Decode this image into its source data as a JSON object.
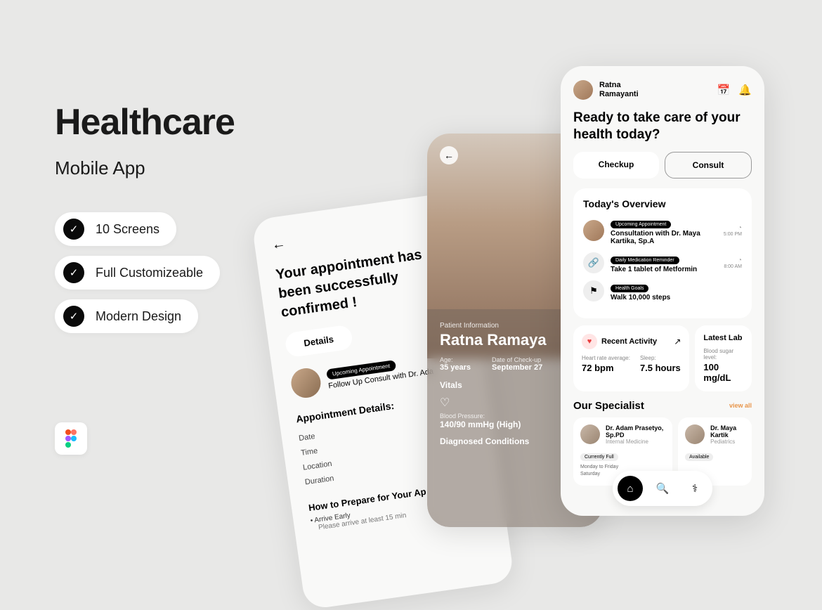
{
  "hero": {
    "title": "Healthcare",
    "subtitle": "Mobile App",
    "features": [
      "10 Screens",
      "Full Customizeable",
      "Modern Design"
    ]
  },
  "screenBack": {
    "title": "Your appointment has been successfully confirmed !",
    "detailsBtn": "Details",
    "apptChip": "Upcoming Appointment",
    "apptText": "Follow Up Consult with Dr. Ada",
    "sectionTitle": "Appointment Details:",
    "fields": [
      "Date",
      "Time",
      "Location",
      "Duration"
    ],
    "prepareTitle": "How to Prepare for Your Ap",
    "bullet1": "Arrive Early",
    "bullet1sub": "Please arrive at least 15 min"
  },
  "screenMid": {
    "infoLabel": "Patient Information",
    "name": "Ratna Ramaya",
    "ageLabel": "Age:",
    "age": "35 years",
    "checkLabel": "Date of Check-up",
    "checkDate": "September 27",
    "vitals": "Vitals",
    "bpLabel": "Blood Pressure:",
    "bpVal": "140/90 mmHg (High)",
    "diagnosed": "Diagnosed Conditions"
  },
  "screenFront": {
    "userName": "Ratna\nRamayanti",
    "title": "Ready to take care of your health today?",
    "tabs": {
      "checkup": "Checkup",
      "consult": "Consult"
    },
    "overview": {
      "title": "Today's Overview",
      "items": [
        {
          "chip": "Upcoming Appointment",
          "text": "Consultation with Dr. Maya Kartika, Sp.A",
          "time": "5:00 PM"
        },
        {
          "chip": "Daily Medication Reminder",
          "text": "Take 1 tablet of Metformin",
          "time": "8:00 AM"
        },
        {
          "chip": "Health Goals",
          "text": "Walk 10,000 steps",
          "time": ""
        }
      ]
    },
    "activity": {
      "title": "Recent Activity",
      "heartLabel": "Heart rate average:",
      "heartVal": "72 bpm",
      "sleepLabel": "Sleep:",
      "sleepVal": "7.5 hours",
      "labTitle": "Latest Lab",
      "labLabel": "Blood sugar level:",
      "labVal": "100 mg/dL"
    },
    "specialist": {
      "title": "Our Specialist",
      "viewAll": "view all",
      "items": [
        {
          "name": "Dr. Adam Prasetyo, Sp.PD",
          "role": "Internal Medicine",
          "chip": "Currently Full",
          "sched": [
            "Monday to Friday",
            "Saturday"
          ]
        },
        {
          "name": "Dr. Maya Kartik",
          "role": "Pediatrics",
          "chip": "Available"
        }
      ]
    }
  }
}
